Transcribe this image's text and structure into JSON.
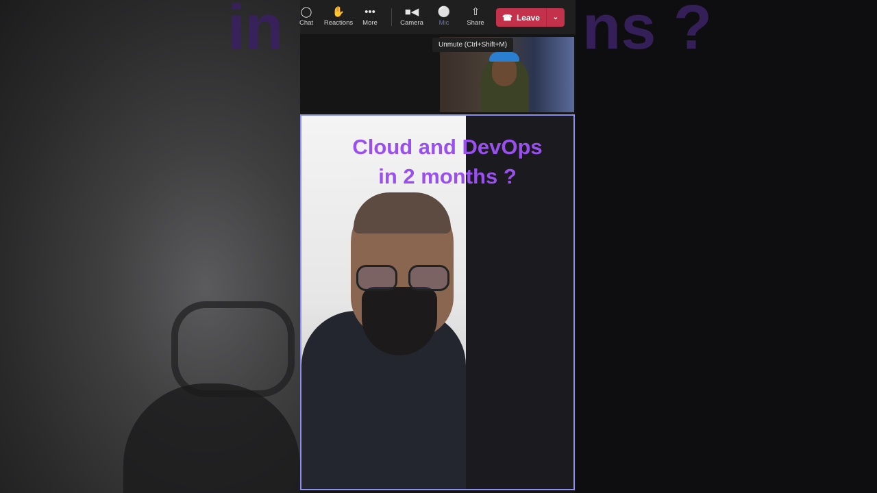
{
  "toolbar": {
    "items": [
      {
        "label": "Chat",
        "icon": "chat-icon"
      },
      {
        "label": "Reactions",
        "icon": "reactions-icon"
      },
      {
        "label": "More",
        "icon": "more-icon"
      },
      {
        "label": "Camera",
        "icon": "camera-icon"
      },
      {
        "label": "Mic",
        "icon": "mic-off-icon"
      },
      {
        "label": "Share",
        "icon": "share-icon"
      }
    ],
    "leave_label": "Leave"
  },
  "tooltip": "Unmute (Ctrl+Shift+M)",
  "overlay": {
    "line1": "Cloud and DevOps",
    "line2": "in 2 months ?"
  },
  "background_text": {
    "left": "in",
    "right": "ns ?"
  },
  "colors": {
    "accent": "#9a4ff0",
    "leave": "#c4314b",
    "border": "#8b8ff0"
  }
}
